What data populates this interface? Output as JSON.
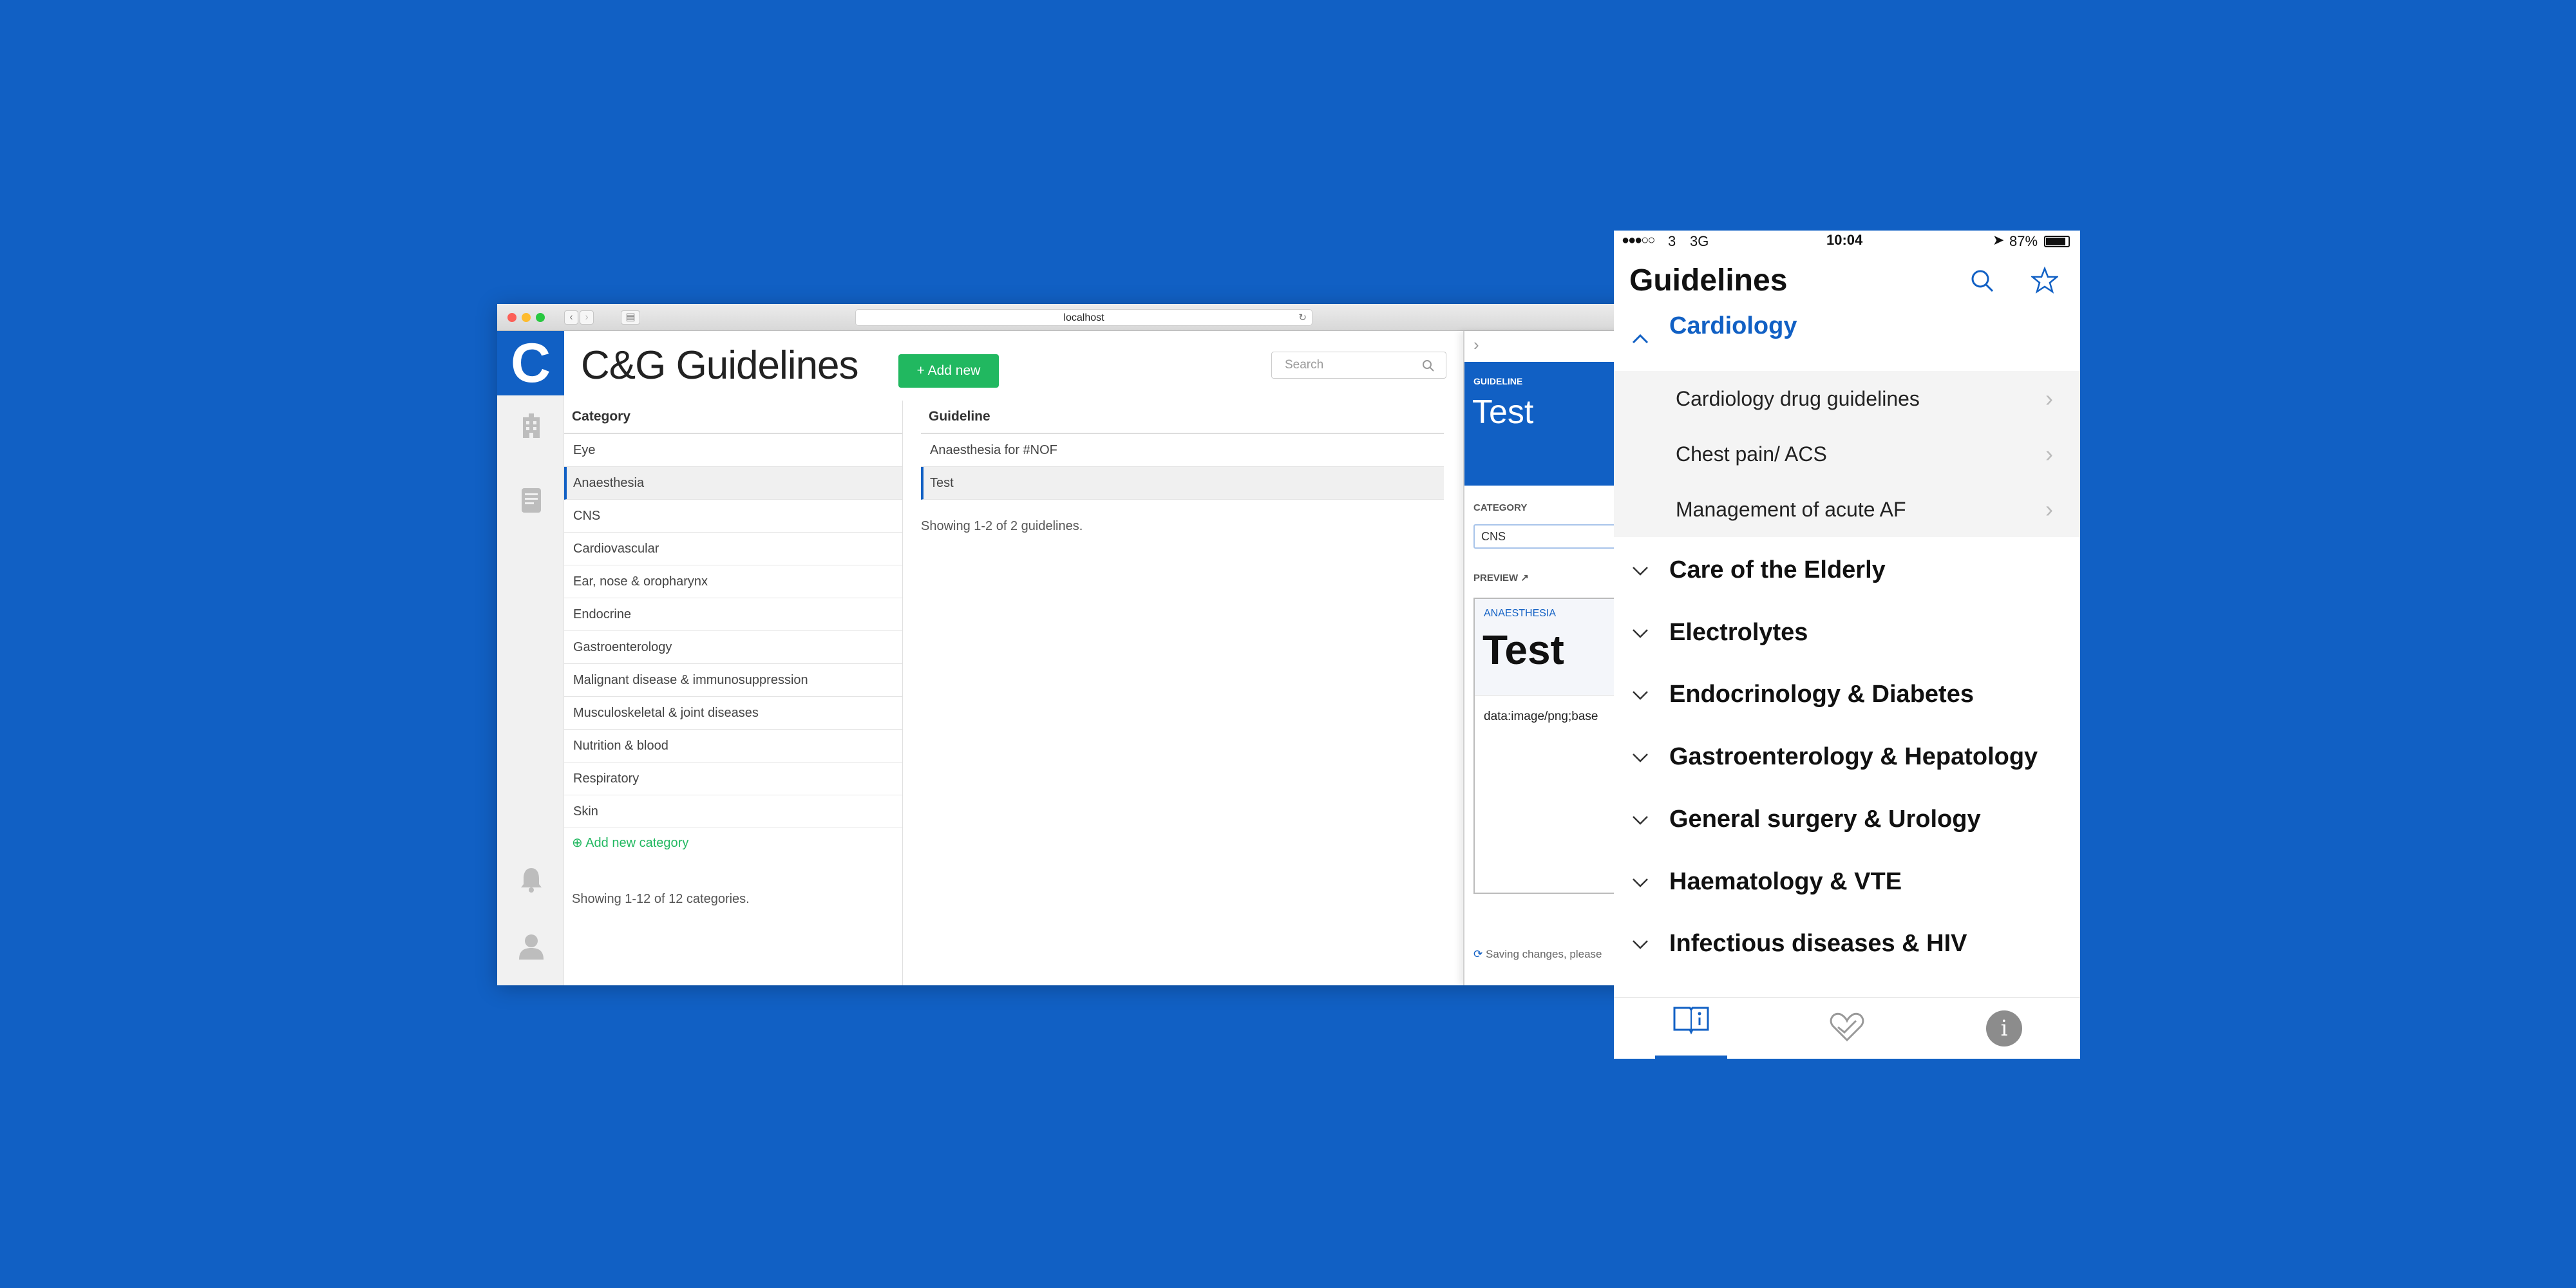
{
  "colors": {
    "background": "#1160c4",
    "accent": "#1160c4",
    "add_button": "#21b860"
  },
  "browser": {
    "url": "localhost",
    "app_title": "C&G Guidelines",
    "logo_letter": "C",
    "add_new_label": "+ Add new",
    "search_placeholder": "Search",
    "category_header": "Category",
    "categories": [
      "Eye",
      "Anaesthesia",
      "CNS",
      "Cardiovascular",
      "Ear, nose & oropharynx",
      "Endocrine",
      "Gastroenterology",
      "Malignant disease & immunosuppression",
      "Musculoskeletal & joint diseases",
      "Nutrition & blood",
      "Respiratory",
      "Skin"
    ],
    "selected_category": "Anaesthesia",
    "add_category_label": "Add new category",
    "categories_footer": "Showing 1-12 of 12 categories.",
    "guideline_header": "Guideline",
    "guidelines": [
      "Anaesthesia for #NOF",
      "Test"
    ],
    "selected_guideline": "Test",
    "guidelines_footer": "Showing 1-2 of 2 guidelines.",
    "panel": {
      "section_label": "GUIDELINE",
      "title": "Test",
      "category_label": "CATEGORY",
      "category_value": "CNS",
      "preview_label": "PREVIEW",
      "preview_category": "ANAESTHESIA",
      "preview_title": "Test",
      "preview_body": "data:image/png;base",
      "saving_text": "Saving changes, please"
    }
  },
  "phone": {
    "status": {
      "carrier": "3",
      "network": "3G",
      "time": "10:04",
      "battery": "87%"
    },
    "title": "Guidelines",
    "expanded_group": "Cardiology",
    "subitems": [
      "Cardiology drug guidelines",
      "Chest pain/ ACS",
      "Management of acute AF"
    ],
    "groups": [
      "Care of the Elderly",
      "Electrolytes",
      "Endocrinology & Diabetes",
      "Gastroenterology & Hepatology",
      "General surgery & Urology",
      "Haematology & VTE",
      "Infectious diseases & HIV"
    ],
    "icons": [
      "search-icon",
      "star-icon",
      "guidelines-tab-icon",
      "favourites-tab-icon",
      "info-tab-icon"
    ]
  }
}
